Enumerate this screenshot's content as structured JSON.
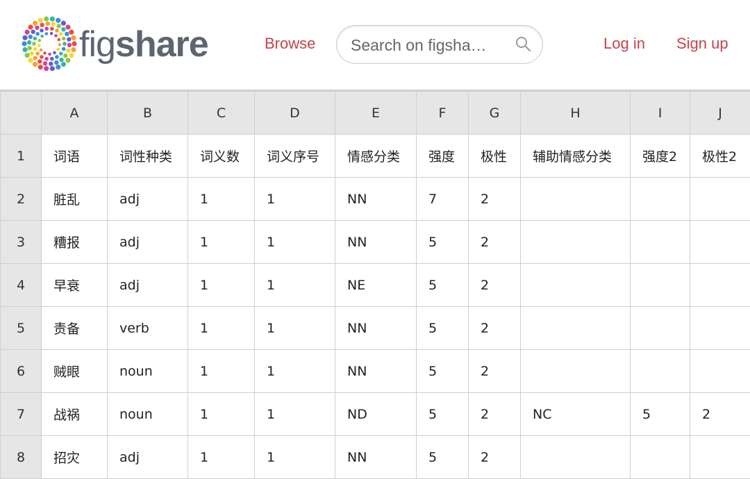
{
  "header": {
    "logo": {
      "prefix": "fig",
      "suffix": "share"
    },
    "browse_label": "Browse",
    "search": {
      "placeholder": "Search on figsha…"
    },
    "login_label": "Log in",
    "signup_label": "Sign up",
    "link_color": "#c6424a"
  },
  "sheet": {
    "columns": [
      "A",
      "B",
      "C",
      "D",
      "E",
      "F",
      "G",
      "H",
      "I",
      "J"
    ],
    "rows": [
      {
        "num": "1",
        "cells": [
          "词语",
          "词性种类",
          "词义数",
          "词义序号",
          "情感分类",
          "强度",
          "极性",
          "辅助情感分类",
          "强度2",
          "极性2"
        ]
      },
      {
        "num": "2",
        "cells": [
          "脏乱",
          "adj",
          "1",
          "1",
          "NN",
          "7",
          "2",
          "",
          "",
          ""
        ]
      },
      {
        "num": "3",
        "cells": [
          "糟报",
          "adj",
          "1",
          "1",
          "NN",
          "5",
          "2",
          "",
          "",
          ""
        ]
      },
      {
        "num": "4",
        "cells": [
          "早衰",
          "adj",
          "1",
          "1",
          "NE",
          "5",
          "2",
          "",
          "",
          ""
        ]
      },
      {
        "num": "5",
        "cells": [
          "责备",
          "verb",
          "1",
          "1",
          "NN",
          "5",
          "2",
          "",
          "",
          ""
        ]
      },
      {
        "num": "6",
        "cells": [
          "贼眼",
          "noun",
          "1",
          "1",
          "NN",
          "5",
          "2",
          "",
          "",
          ""
        ]
      },
      {
        "num": "7",
        "cells": [
          "战祸",
          "noun",
          "1",
          "1",
          "ND",
          "5",
          "2",
          "NC",
          "5",
          "2"
        ]
      },
      {
        "num": "8",
        "cells": [
          "招灾",
          "adj",
          "1",
          "1",
          "NN",
          "5",
          "2",
          "",
          "",
          ""
        ]
      }
    ]
  }
}
